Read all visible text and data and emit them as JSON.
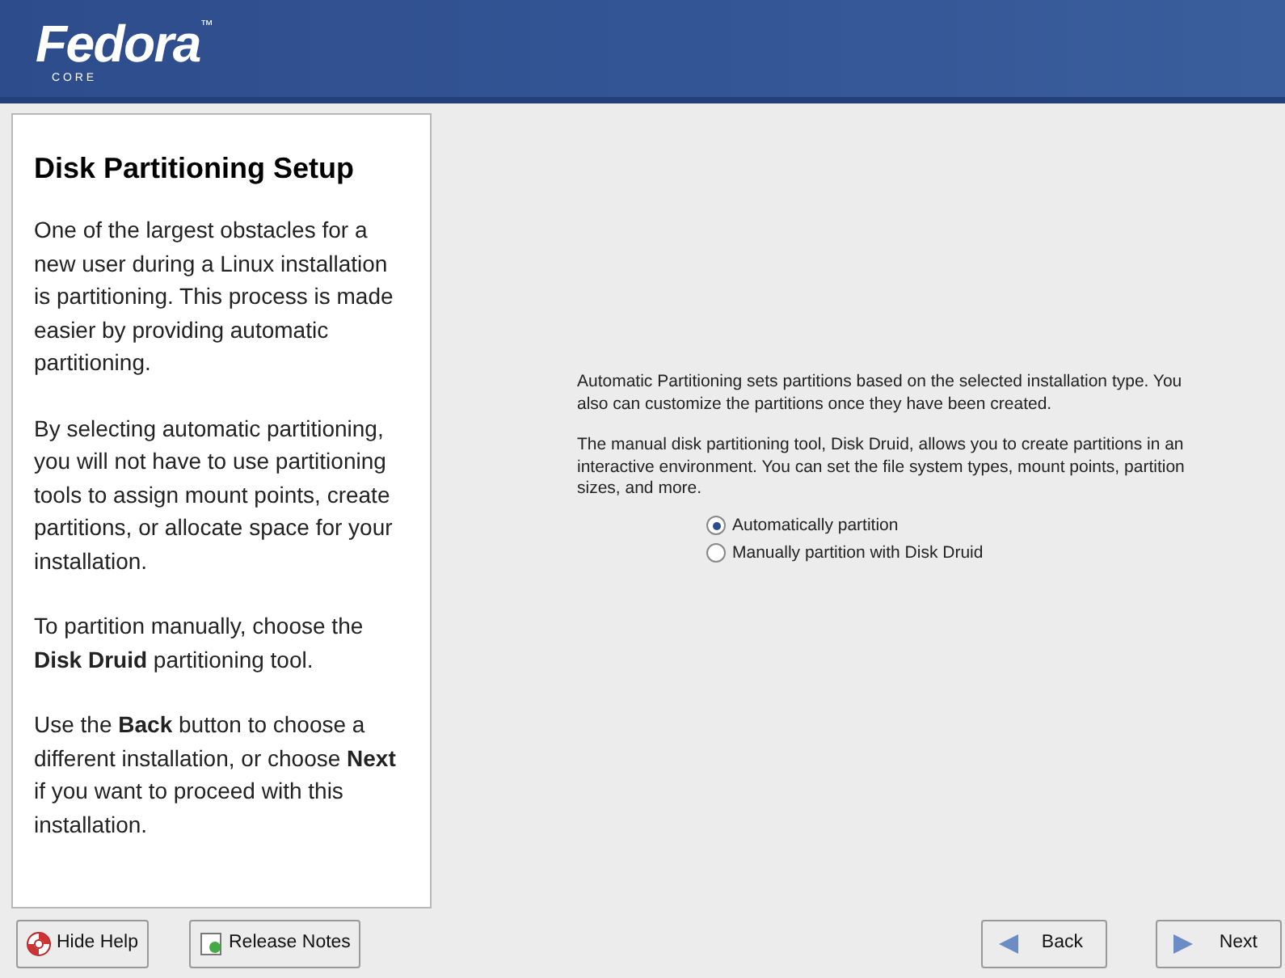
{
  "banner": {
    "logo": "Fedora",
    "trademark": "™",
    "subtitle": "C O R E"
  },
  "help": {
    "title": "Disk Partitioning Setup",
    "paragraphs": [
      "One of the largest obstacles for a new user during a Linux installation is partitioning. This process is made easier by providing automatic partitioning.",
      "By selecting automatic partitioning, you will not have to use partitioning tools to assign mount points, create partitions, or allocate space for your installation.",
      "To partition manually, choose the **Disk Druid** partitioning tool.",
      "Use the **Back** button to choose a different installation, or choose **Next** if you want to proceed with this installation."
    ]
  },
  "content": {
    "paragraphs": [
      "Automatic Partitioning sets partitions based on the selected installation type. You also can customize the partitions once they have been created.",
      "The manual disk partitioning tool, Disk Druid, allows you to create partitions in an interactive environment. You can set the file system types, mount points, partition sizes, and more."
    ],
    "options": [
      {
        "label": "Automatically partition",
        "selected": true
      },
      {
        "label": "Manually partition with Disk Druid",
        "selected": false
      }
    ]
  },
  "buttons": [
    {
      "kind": "help",
      "label": "Hide Help"
    },
    {
      "kind": "notes",
      "label": "Release Notes"
    },
    {
      "kind": "back",
      "label": "Back"
    },
    {
      "kind": "next",
      "label": "Next"
    }
  ]
}
